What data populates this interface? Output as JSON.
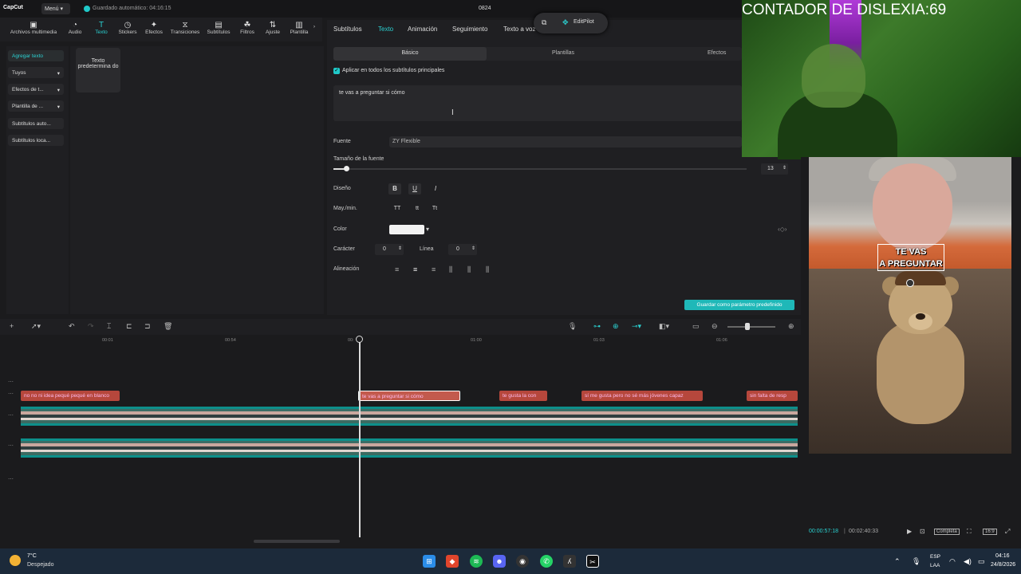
{
  "app": {
    "logo": "CapCut",
    "menu_label": "Menú",
    "autosave": "Guardado automático: 04:16:15",
    "project_name": "0824"
  },
  "tool_tabs": [
    "Archivos multimedia",
    "Audio",
    "Texto",
    "Stickers",
    "Efectos",
    "Transiciones",
    "Subtítulos",
    "Filtros",
    "Ajuste",
    "Plantilla"
  ],
  "left_sidebar": [
    "Agregar texto",
    "Tuyos",
    "Efectos de t...",
    "Plantilla de ...",
    "Subtítulos auto...",
    "Subtítulos loca..."
  ],
  "default_text_card": "Texto predetermina do",
  "props": {
    "tabs": [
      "Subtítulos",
      "Texto",
      "Animación",
      "Seguimiento",
      "Texto a voz"
    ],
    "subtabs": [
      "Básico",
      "Plantillas",
      "Efectos"
    ],
    "apply_all": "Aplicar en todos los subtítulos principales",
    "text_value": "te vas a preguntar si cómo",
    "font_label": "Fuente",
    "font_value": "ZY Flexible",
    "fontsize_label": "Tamaño de la fuente",
    "fontsize_value": "13",
    "fontsize_fraction": 0.03,
    "design_label": "Diseño",
    "case_label": "May./min.",
    "case_opts": [
      "TT",
      "tt",
      "Tt"
    ],
    "color_label": "Color",
    "color_value": "#f2f2f2",
    "char_label": "Carácter",
    "char_value": "0",
    "line_label": "Línea",
    "line_value": "0",
    "align_label": "Alineación",
    "save_preset": "Guardar como parámetro predefinido"
  },
  "editpilot": "EditPilot",
  "timeline": {
    "ticks": [
      "00:01",
      "00:54",
      "00:",
      "01:00",
      "01:03",
      "01:06"
    ],
    "captions": [
      "no no ni idea pequé pequé en blanco",
      "te vas a preguntar si cómo",
      "te gusta la con",
      "sí me gusta pero no sé más jóvenes capaz",
      "sin falta de resp"
    ]
  },
  "overlay": {
    "counter": "CONTADOR DE DISLEXIA:69",
    "subtitle_line1": "TE VAS",
    "subtitle_line2": "A PREGUNTAR"
  },
  "playback": {
    "current": "00:00:57:18",
    "total": "00:02:40:33",
    "mode": "Completa",
    "ratio": "16:9"
  },
  "taskbar": {
    "temp": "7°C",
    "weather": "Despejado",
    "lang1": "ESP",
    "lang2": "LAA",
    "time": "04:16",
    "date": "24/8/2026"
  },
  "colors": {
    "accent": "#2bd2d2",
    "caption": "#b6473c"
  }
}
